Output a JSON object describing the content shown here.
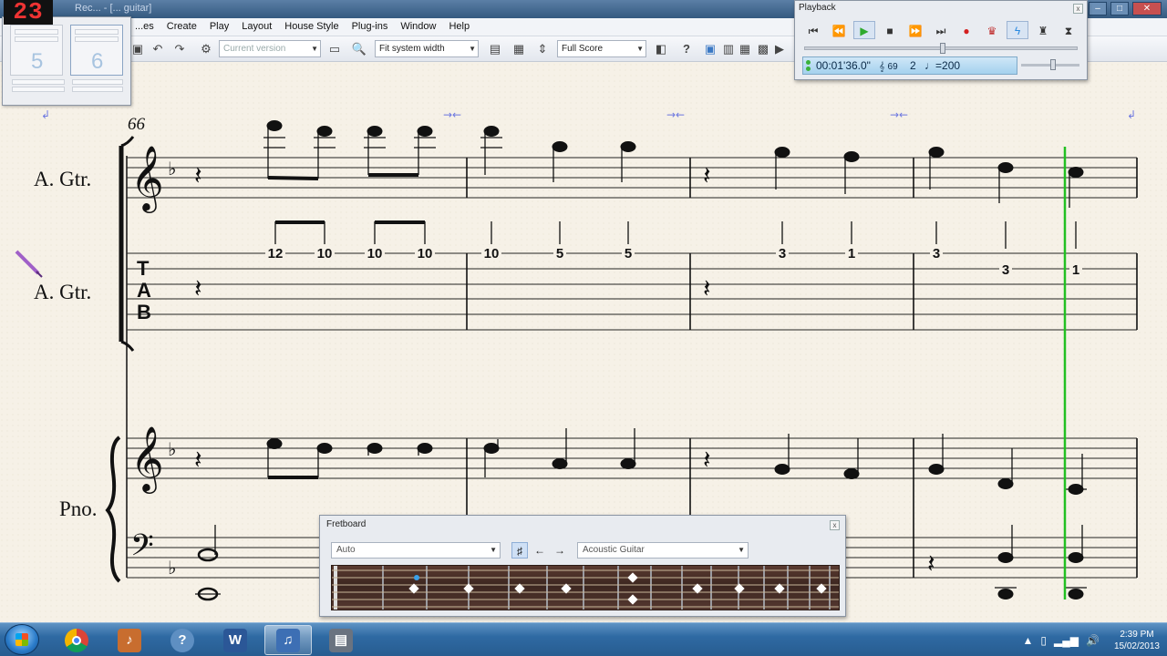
{
  "window": {
    "title": "Rec... - [... guitar]",
    "controls": [
      "–",
      "□",
      "✕"
    ]
  },
  "counter": "23",
  "menu": [
    "...es",
    "Create",
    "Play",
    "Layout",
    "House Style",
    "Plug-ins",
    "Window",
    "Help"
  ],
  "toolbar": {
    "version_combo": "Current version",
    "zoom_combo": "Fit system width",
    "view_combo": "Full Score",
    "help": "?"
  },
  "keypad": {
    "numbers": [
      "5",
      "6"
    ]
  },
  "playback": {
    "title": "Playback",
    "close": "x",
    "time": "00:01'36.0\"",
    "bar_icon": "𝄞",
    "bar_number": "69",
    "beat": "2",
    "tempo": "♩=200"
  },
  "score": {
    "measure_number": "66",
    "instruments": [
      "A. Gtr.",
      "A. Gtr.",
      "Pno."
    ],
    "tab_letters": [
      "T",
      "A",
      "B"
    ],
    "tab_numbers": [
      "12",
      "10",
      "10",
      "10",
      "10",
      "5",
      "5",
      "3",
      "1",
      "3",
      "3",
      "1"
    ]
  },
  "fretboard": {
    "title": "Fretboard",
    "close": "x",
    "mode": "Auto",
    "instrument": "Acoustic Guitar"
  },
  "taskbar": {
    "apps": [
      "Start",
      "Chrome",
      "Sibelius",
      "Help",
      "Word",
      "Sibelius Score",
      "Explorer"
    ],
    "time": "2:39 PM",
    "date": "15/02/2013"
  },
  "colors": {
    "playback_line": "#22c022",
    "lcd": "#a4d1ee",
    "paper": "#f6f1e7",
    "taskbar": "#2f6aa3"
  }
}
